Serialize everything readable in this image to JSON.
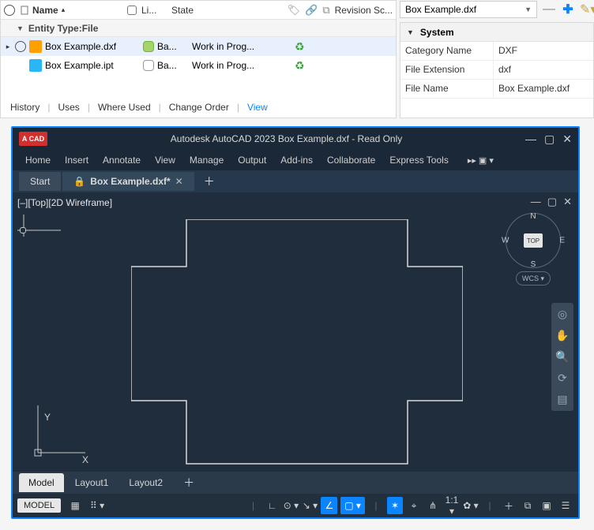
{
  "browser": {
    "cols": {
      "name": "Name",
      "li": "Li...",
      "state": "State",
      "rev": "Revision Sc..."
    },
    "group": "Entity Type:File",
    "rows": [
      {
        "name": "Box Example.dxf",
        "li": "Ba...",
        "state": "Work in Prog..."
      },
      {
        "name": "Box Example.ipt",
        "li": "Ba...",
        "state": "Work in Prog..."
      }
    ],
    "tabs": {
      "history": "History",
      "uses": "Uses",
      "where": "Where Used",
      "change": "Change Order",
      "view": "View"
    }
  },
  "details": {
    "combo": "Box Example.dxf",
    "panel_title": "System",
    "rows": [
      {
        "k": "Category Name",
        "v": "DXF"
      },
      {
        "k": "File Extension",
        "v": "dxf"
      },
      {
        "k": "File Name",
        "v": "Box Example.dxf"
      }
    ]
  },
  "cad": {
    "logo": "A CAD",
    "title": "Autodesk AutoCAD 2023    Box Example.dxf - Read Only",
    "menu": [
      "Home",
      "Insert",
      "Annotate",
      "View",
      "Manage",
      "Output",
      "Add-ins",
      "Collaborate",
      "Express Tools"
    ],
    "menu_more": "▸▸  ▣ ▾",
    "tabs": {
      "start": "Start",
      "doc": "Box Example.dxf*"
    },
    "viewport_label": "[–][Top][2D Wireframe]",
    "axis": {
      "y": "Y",
      "x": "X"
    },
    "compass": {
      "n": "N",
      "s": "S",
      "e": "E",
      "w": "W",
      "top": "TOP",
      "wcs": "WCS ▾"
    },
    "strip": {
      "model": "Model",
      "l1": "Layout1",
      "l2": "Layout2"
    },
    "status": {
      "model": "MODEL",
      "scale": "1:1 ▾"
    }
  }
}
